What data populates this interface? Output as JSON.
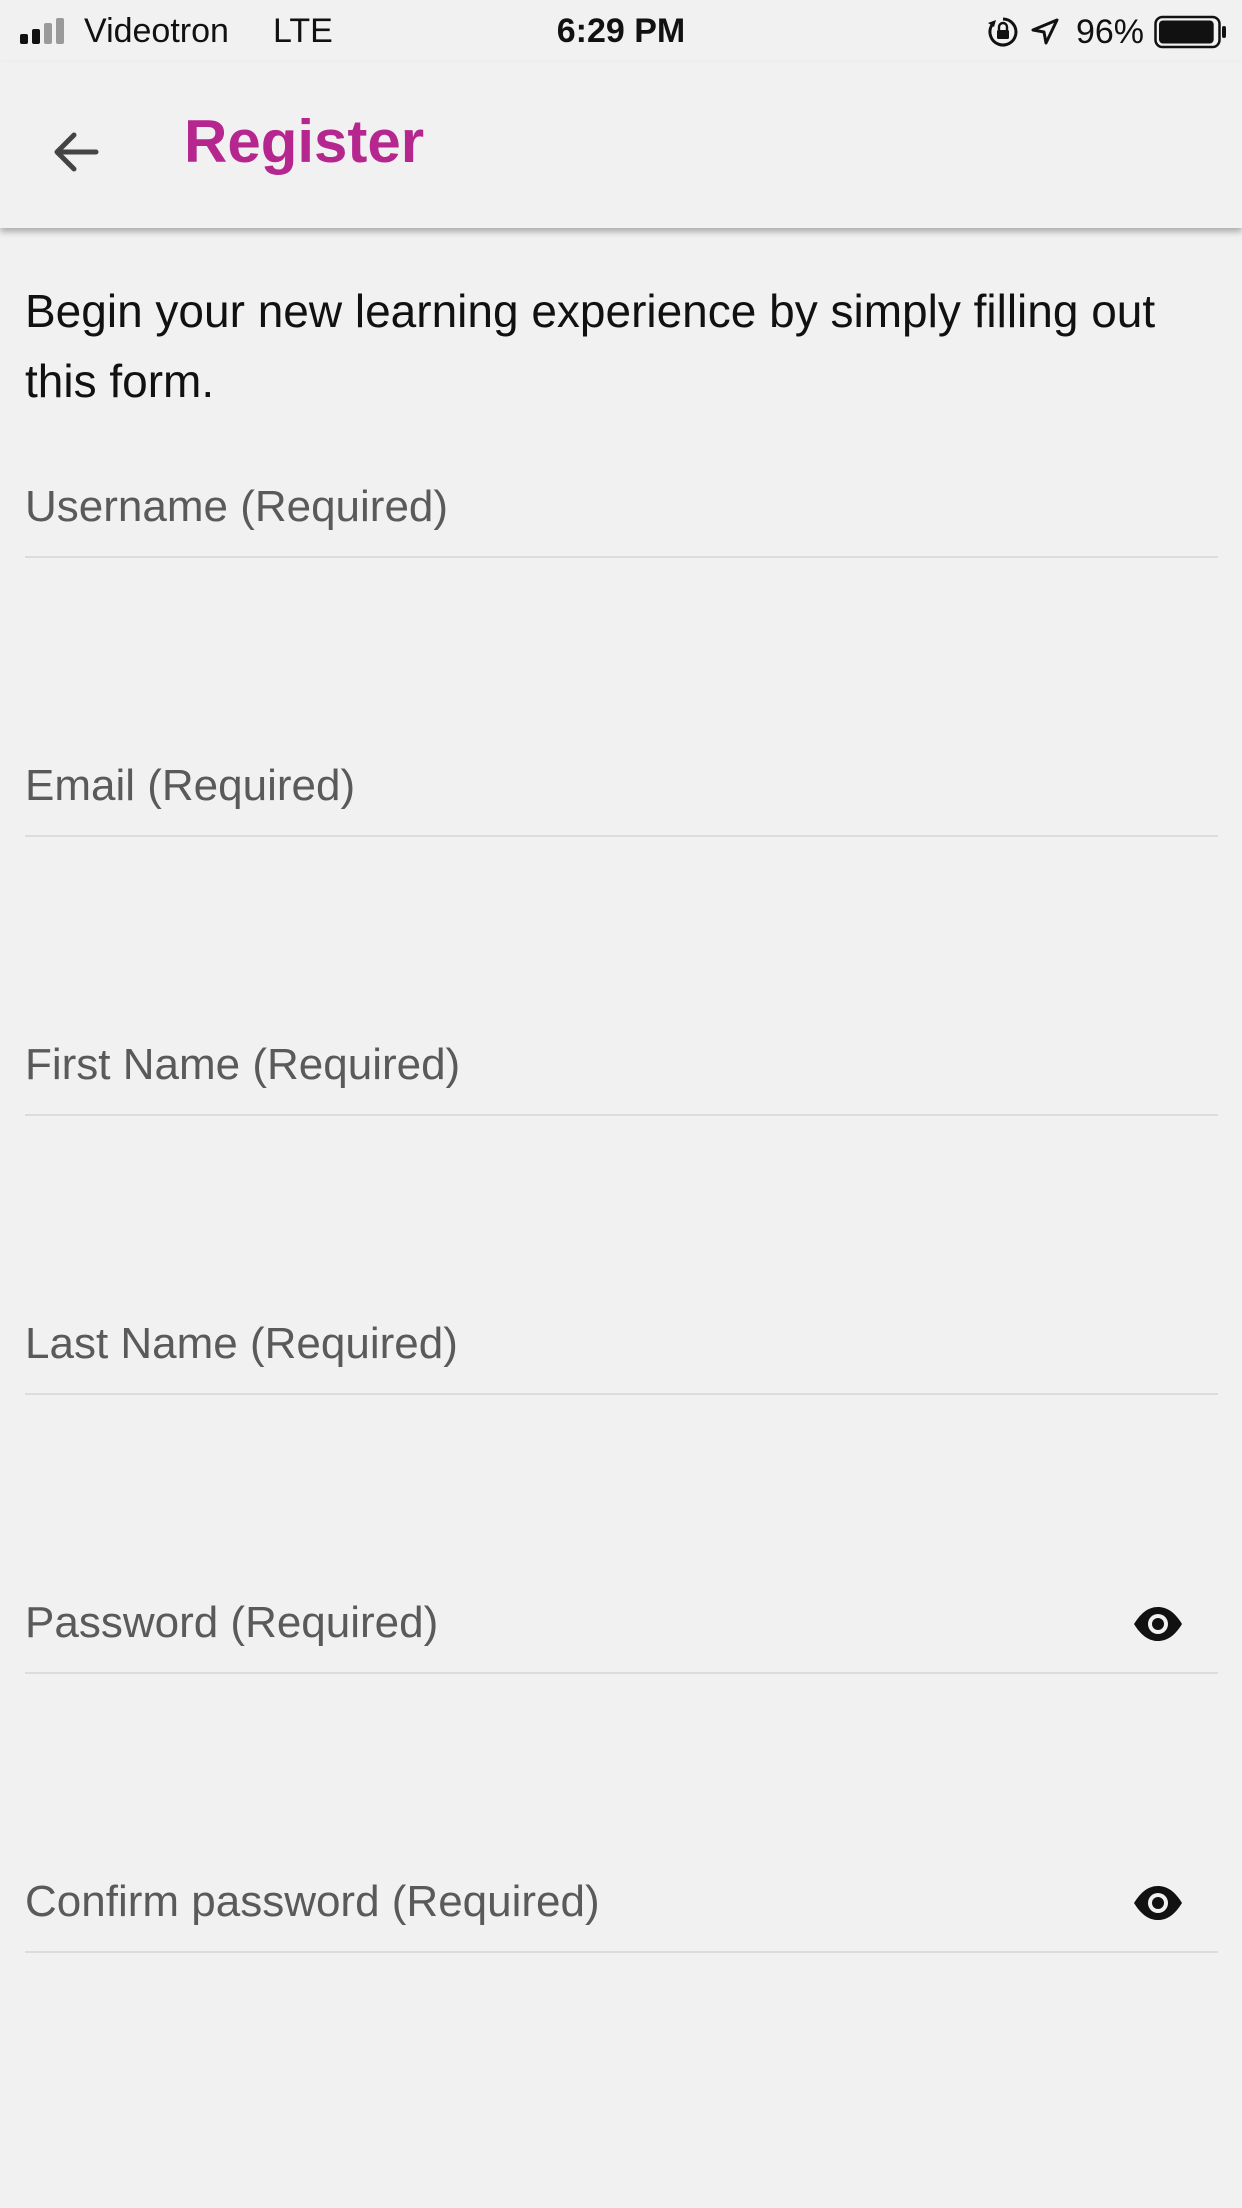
{
  "status_bar": {
    "carrier": "Videotron",
    "network": "LTE",
    "time": "6:29 PM",
    "battery": "96%",
    "battery_level": 0.96,
    "icons": [
      "signal-icon",
      "orientation-lock-icon",
      "location-arrow-icon",
      "battery-icon"
    ]
  },
  "header": {
    "title": "Register",
    "back_icon": "arrow-left-icon",
    "title_color": "#b5278f"
  },
  "form": {
    "intro": "Begin your new learning experience by simply filling out this form.",
    "fields": [
      {
        "placeholder": "Username (Required)"
      },
      {
        "placeholder": "Email (Required)"
      },
      {
        "placeholder": "First Name (Required)"
      },
      {
        "placeholder": "Last Name (Required)"
      },
      {
        "placeholder": "Password (Required)",
        "icon": "eye-icon"
      },
      {
        "placeholder": "Confirm password (Required)",
        "icon": "eye-icon"
      }
    ]
  }
}
